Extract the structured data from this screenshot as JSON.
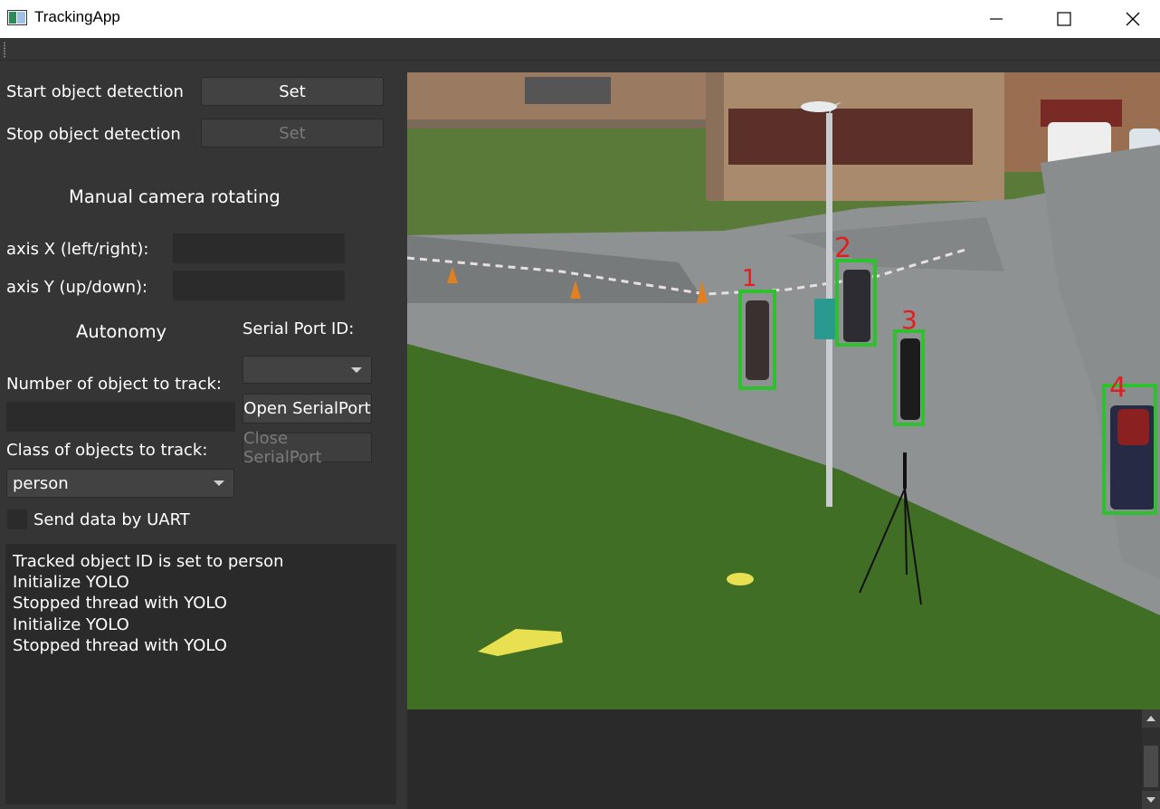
{
  "window": {
    "title": "TrackingApp",
    "minimize_icon": "minimize-icon",
    "maximize_icon": "maximize-icon",
    "close_icon": "close-icon"
  },
  "detection": {
    "start_label": "Start object detection",
    "start_button": "Set",
    "stop_label": "Stop object detection",
    "stop_button": "Set"
  },
  "manual": {
    "heading": "Manual camera rotating",
    "axis_x_label": "axis X (left/right):",
    "axis_x_value": "",
    "axis_y_label": "axis Y (up/down):",
    "axis_y_value": ""
  },
  "autonomy": {
    "heading": "Autonomy",
    "number_label": "Number of object to track:",
    "number_value": "",
    "class_label": "Class of objects to track:",
    "class_selected": "person",
    "send_uart_label": "Send data by UART",
    "send_uart_checked": false
  },
  "serial": {
    "heading": "Serial Port ID:",
    "port_selected": "",
    "open_button": "Open SerialPort",
    "close_button": "Close SerialPort"
  },
  "log": {
    "lines": [
      "Tracked object ID is set to person",
      "Initialize YOLO",
      "Stopped thread with YOLO",
      "Initialize YOLO",
      "Stopped thread with YOLO"
    ]
  },
  "video": {
    "tracks": [
      {
        "id": "1"
      },
      {
        "id": "2"
      },
      {
        "id": "3"
      },
      {
        "id": "4"
      }
    ],
    "box_color": "#2fc02f",
    "label_color": "#e02020"
  },
  "colors": {
    "background": "#353535",
    "field": "#2b2b2b",
    "button": "#424242"
  }
}
